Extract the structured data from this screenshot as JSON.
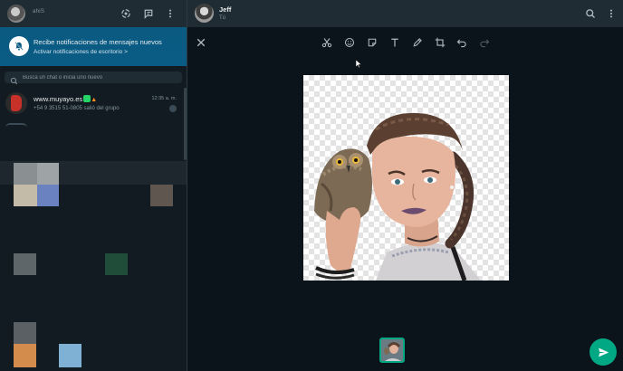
{
  "left_header": {
    "me_label": "ahiS",
    "icons": [
      "status-icon",
      "new-chat-icon",
      "menu-icon"
    ]
  },
  "notification": {
    "title": "Recibe notificaciones de mensajes nuevos",
    "subtitle": "Activar notificaciones de escritorio >"
  },
  "search": {
    "placeholder": "Busca un chat o inicia uno nuevo"
  },
  "chats": [
    {
      "name": "www.muyayo.es",
      "time": "12:35 a. m.",
      "message": "+54 9 3515 51-0805 salió del grupo"
    }
  ],
  "conversation": {
    "title": "Jeff",
    "subtitle": "Tú"
  },
  "editor_tools": [
    "scissors-icon",
    "emoji-icon",
    "sticker-icon",
    "text-icon",
    "pen-icon",
    "crop-icon",
    "undo-icon",
    "redo-icon"
  ],
  "colors": {
    "accent": "#00a884",
    "banner": "#0a5b83",
    "panel": "#202c33",
    "background": "#0b141a"
  }
}
